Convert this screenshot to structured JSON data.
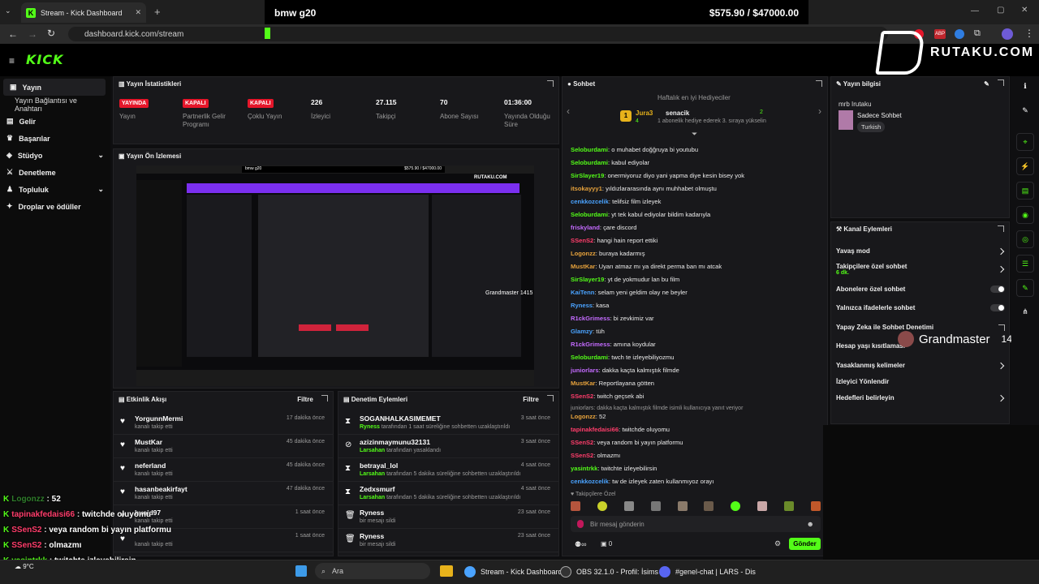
{
  "browser": {
    "tab_title": "Stream - Kick Dashboard",
    "url": "dashboard.kick.com/stream"
  },
  "overlay": {
    "stream_title": "bmw g20",
    "goal": "$575.90 / $47000.00",
    "brand": "RUTAKU.COM",
    "grandmaster": "Grandmaster",
    "grandmaster_num": "1415",
    "chat": [
      {
        "user": "Logonzz",
        "msg": "52",
        "color": "#2f7d2b"
      },
      {
        "user": "tapinakfedaisi66",
        "msg": "twitchde oluyomu",
        "color": "#ff3d6b"
      },
      {
        "user": "SSenS2",
        "msg": "veya random bi yayın platformu",
        "color": "#ff3d6b"
      },
      {
        "user": "SSenS2",
        "msg": "olmazmı",
        "color": "#ff3d6b"
      },
      {
        "user": "yasintrkk",
        "msg": "twitchte izleyebilirsin",
        "color": "#53fc18"
      },
      {
        "user": "cenkkozcelik",
        "msg": "tw de izleyek zaten kullanmıyoz orayı",
        "color": "#4aa3ff"
      }
    ]
  },
  "header": {
    "logo": "KICK"
  },
  "sidebar": {
    "items": [
      {
        "label": "Yayın",
        "icon": "video-icon"
      },
      {
        "label": "Yayın Bağlantısı ve Anahtarı",
        "icon": ""
      },
      {
        "label": "Gelir",
        "icon": "money-icon"
      },
      {
        "label": "Başarılar",
        "icon": "trophy-icon"
      },
      {
        "label": "Stüdyo",
        "icon": "studio-icon"
      },
      {
        "label": "Denetleme",
        "icon": "sword-icon"
      },
      {
        "label": "Topluluk",
        "icon": "community-icon"
      },
      {
        "label": "Droplar ve ödüller",
        "icon": "gift-icon"
      }
    ]
  },
  "stats": {
    "title": "Yayın İstatistikleri",
    "items": [
      {
        "value": "YAYINDA",
        "label": "Yayın",
        "badge": true
      },
      {
        "value": "KAPALI",
        "label": "Partnerlik Gelir Programı",
        "badge": true
      },
      {
        "value": "KAPALI",
        "label": "Çoklu Yayın",
        "badge": true
      },
      {
        "value": "226",
        "label": "İzleyici",
        "badge": false
      },
      {
        "value": "27.115",
        "label": "Takipçi",
        "badge": false
      },
      {
        "value": "70",
        "label": "Abone Sayısı",
        "badge": false
      },
      {
        "value": "01:36:00",
        "label": "Yayında Olduğu Süre",
        "badge": false
      }
    ]
  },
  "preview": {
    "title": "Yayın Ön İzlemesi"
  },
  "activity": {
    "title": "Etkinlik Akışı",
    "filter": "Filtre",
    "items": [
      {
        "name": "YorgunnMermi",
        "sub": "kanalı takip etti",
        "time": "17 dakika önce"
      },
      {
        "name": "MustKar",
        "sub": "kanalı takip etti",
        "time": "45 dakika önce"
      },
      {
        "name": "neferland",
        "sub": "kanalı takip etti",
        "time": "45 dakika önce"
      },
      {
        "name": "hasanbeakirfayt",
        "sub": "kanalı takip etti",
        "time": "47 dakika önce"
      },
      {
        "name": "bvoid97",
        "sub": "kanalı takip etti",
        "time": "1 saat önce"
      },
      {
        "name": "",
        "sub": "kanalı takip etti",
        "time": "1 saat önce"
      }
    ]
  },
  "moderation": {
    "title": "Denetim Eylemleri",
    "filter": "Filtre",
    "items": [
      {
        "name": "SOGANHALKASIMEMET",
        "actor": "Ryness",
        "sub": "tarafından 1 saat süreliğine sohbetten uzaklaştırıldı",
        "time": "3 saat önce",
        "icon": "hourglass-icon"
      },
      {
        "name": "azizinmaymunu32131",
        "actor": "Larsahan",
        "sub": "tarafından yasaklandı",
        "time": "3 saat önce",
        "icon": "ban-icon"
      },
      {
        "name": "betrayal_lol",
        "actor": "Larsahan",
        "sub": "tarafından 5 dakika süreliğine sohbetten uzaklaştırıldı",
        "time": "4 saat önce",
        "icon": "hourglass-icon"
      },
      {
        "name": "Zedxsmurf",
        "actor": "Larsahan",
        "sub": "tarafından 5 dakika süreliğine sohbetten uzaklaştırıldı",
        "time": "4 saat önce",
        "icon": "hourglass-icon"
      },
      {
        "name": "Ryness",
        "actor": "",
        "sub": "bir mesajı sildi",
        "time": "23 saat önce",
        "icon": "trash-icon"
      },
      {
        "name": "Ryness",
        "actor": "",
        "sub": "bir mesajı sildi",
        "time": "23 saat önce",
        "icon": "trash-icon"
      }
    ]
  },
  "chat": {
    "title": "Sohbet",
    "gifter_heading": "Haftalık en iyi Hediyeciler",
    "gifter1": {
      "name": "Jura3",
      "count": "4",
      "rank": "1"
    },
    "gifter2": {
      "name": "senacik",
      "count": "2",
      "note": "1 abonelik hediye ederek 3. sıraya yükselin"
    },
    "messages": [
      {
        "user": "Seloburdami",
        "msg": "o muhabet doğğruya bi youtubu",
        "color": "#53fc18"
      },
      {
        "user": "Seloburdami",
        "msg": "kabul ediyolar",
        "color": "#53fc18"
      },
      {
        "user": "SirSlayer19",
        "msg": "onermiyoruz diyo yani yapma diye kesin bisey yok",
        "color": "#53fc18"
      },
      {
        "user": "itsokayyy1",
        "msg": "yıldızlararasında aynı muhhabet olmuştu",
        "color": "#e6a23c"
      },
      {
        "user": "cenkkozcelik",
        "msg": "telifsiz film izleyek",
        "color": "#4aa3ff"
      },
      {
        "user": "Seloburdami",
        "msg": "yt tek kabul ediyolar bildim kadarıyla",
        "color": "#53fc18"
      },
      {
        "user": "friskyland",
        "msg": "çare discord",
        "color": "#c46bff"
      },
      {
        "user": "SSenS2",
        "msg": "hangi hain report ettiki",
        "color": "#ff3d6b"
      },
      {
        "user": "Logonzz",
        "msg": "buraya kadarmış",
        "color": "#e6a23c"
      },
      {
        "user": "MustKar",
        "msg": "Uyarı atmaz mı ya direkt perma ban mı atcak",
        "color": "#e6a23c"
      },
      {
        "user": "SirSlayer19",
        "msg": "yt de yokmudur lan bu film",
        "color": "#53fc18"
      },
      {
        "user": "KaiTenn",
        "msg": "selam yeni geldim olay ne beyler",
        "color": "#4aa3ff"
      },
      {
        "user": "Ryness",
        "msg": "kasa",
        "color": "#4aa3ff"
      },
      {
        "user": "R1ckGrimess",
        "msg": "bi zevkimiz var",
        "color": "#c46bff"
      },
      {
        "user": "Glamzy",
        "msg": "tüh",
        "color": "#4aa3ff"
      },
      {
        "user": "R1ckGrimess",
        "msg": "amına koydular",
        "color": "#c46bff"
      },
      {
        "user": "Seloburdami",
        "msg": "twch te izleyebiliyozmu",
        "color": "#53fc18"
      },
      {
        "user": "juniorlars",
        "msg": "dakka kaçta kalmıştık filmde",
        "color": "#c46bff"
      },
      {
        "user": "MustKar",
        "msg": "Reportlayana götten",
        "color": "#e6a23c"
      },
      {
        "user": "SSenS2",
        "msg": "twitch geçsek abi",
        "color": "#ff3d6b"
      }
    ],
    "reply_note": "juniorlars: dakka kaçta kalmıştık filmde isimli kullanıcıya yanıt veriyor",
    "messages2": [
      {
        "user": "Logonzz",
        "msg": "52",
        "color": "#e6a23c"
      },
      {
        "user": "tapinakfedaisi66",
        "msg": "twitchde oluyomu",
        "color": "#ff3d6b"
      },
      {
        "user": "SSenS2",
        "msg": "veya random bi yayın platformu",
        "color": "#ff3d6b"
      },
      {
        "user": "SSenS2",
        "msg": "olmazmı",
        "color": "#ff3d6b"
      },
      {
        "user": "yasintrkk",
        "msg": "twitchte izleyebilirsin",
        "color": "#53fc18"
      },
      {
        "user": "cenkkozcelik",
        "msg": "tw de izleyek zaten kullanmıyoz orayı",
        "color": "#4aa3ff"
      }
    ],
    "followers_only": "Takipçilere Özel",
    "input_placeholder": "Bir mesaj gönderin",
    "count": "0",
    "send": "Gönder"
  },
  "info": {
    "title": "Yayın bilgisi",
    "stream_title": "mrb Irutaku",
    "category": "Sadece Sohbet",
    "tag": "Turkish"
  },
  "channel_actions": {
    "title": "Kanal Eylemleri",
    "items": [
      {
        "label": "Yavaş mod",
        "sub": "",
        "control": "chevron"
      },
      {
        "label": "Takipçilere özel sohbet",
        "sub": "6 dk.",
        "control": "chevron"
      },
      {
        "label": "Abonelere özel sohbet",
        "sub": "",
        "control": "toggle"
      },
      {
        "label": "Yalnızca ifadelerle sohbet",
        "sub": "",
        "control": "toggle"
      },
      {
        "label": "Yapay Zeka ile Sohbet Denetimi",
        "sub": "",
        "control": "link"
      },
      {
        "label": "Hesap yaşı kısıtlaması",
        "sub": "",
        "control": "chevron"
      },
      {
        "label": "Yasaklanmış kelimeler",
        "sub": "",
        "control": "chevron"
      },
      {
        "label": "İzleyici Yönlendir",
        "sub": "",
        "control": "none"
      },
      {
        "label": "Hedefleri belirleyin",
        "sub": "",
        "control": "chevron"
      }
    ]
  },
  "taskbar": {
    "weather": "9°C",
    "search": "Ara",
    "apps": [
      "Stream - Kick Dashboard",
      "OBS 32.1.0 - Profil: İsims",
      "#genel-chat | LARS - Dis"
    ]
  },
  "colors": {
    "accent": "#53fc18",
    "live": "#e5162a",
    "panel": "#18181b"
  }
}
